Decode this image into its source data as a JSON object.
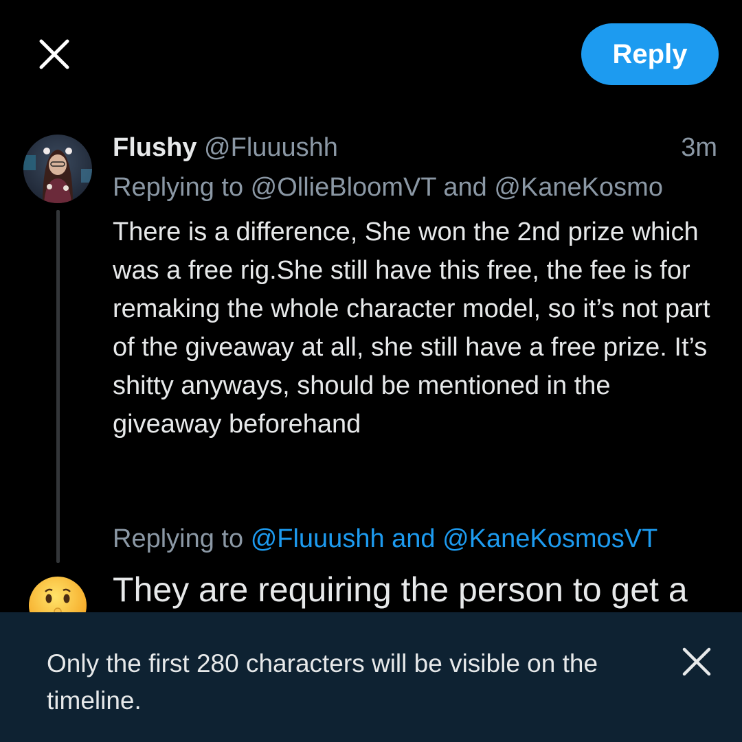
{
  "header": {
    "close_icon": "close-icon",
    "reply_label": "Reply",
    "accent_color": "#1d9bf0"
  },
  "tweet": {
    "display_name": "Flushy",
    "handle": "@Fluuushh",
    "time": "3m",
    "replying_to": "Replying to @OllieBloomVT and @KaneKosmo",
    "text": "There is a difference, She won the 2nd prize which was a free rig.She still have this free, the fee is for remaking the whole character model, so it’s not part of the giveaway at all, she still have a free prize. It’s shitty anyways, should be mentioned in the giveaway beforehand"
  },
  "compose": {
    "replying_label": "Replying to",
    "replying_mentions": "@Fluuushh and @KaneKosmosVT",
    "text": "They are requiring the person to get a",
    "avatar_icon": "shushing-face-emoji"
  },
  "toast": {
    "message": "Only the first 280 characters will be visible on the timeline.",
    "close_icon": "close-icon",
    "background": "#0e2232"
  }
}
